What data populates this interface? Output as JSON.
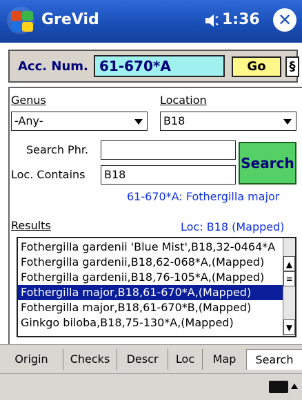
{
  "title_bar": {
    "app_title": "GreVid",
    "time": "1:36",
    "close_label": "✕",
    "sound_icon": "speaker-icon"
  },
  "acc_panel": {
    "label": "Acc. Num.",
    "value": "61-670*A",
    "go_label": "Go",
    "section_label": "§"
  },
  "search_panel": {
    "genus_label": "Genus",
    "genus_value": "-Any-",
    "location_label": "Location",
    "location_value": "B18",
    "search_phr_label": "Search Phr.",
    "search_phr_value": "",
    "loc_contains_label": "Loc. Contains",
    "loc_contains_value": "B18",
    "search_button": "Search",
    "status_text": "61-670*A: Fothergilla major"
  },
  "results": {
    "label": "Results",
    "loc_text": "Loc: B18 (Mapped)",
    "items": [
      "Fothergilla gardenii 'Blue Mist',B18,32-0464*A",
      "Fothergilla gardenii,B18,62-068*A,(Mapped)",
      "Fothergilla gardenii,B18,76-105*A,(Mapped)",
      "Fothergilla major,B18,61-670*A,(Mapped)",
      "Fothergilla major,B18,61-670*B,(Mapped)",
      "Ginkgo biloba,B18,75-130*A,(Mapped)"
    ],
    "selected_index": 3
  },
  "tabs": [
    "Origin",
    "Checks",
    "Descr",
    "Loc",
    "Map",
    "Search"
  ],
  "active_tab": "Search",
  "colors": {
    "title_bar": "#1a4fb8",
    "acc_input_bg": "#9ff0ee",
    "go_button_bg": "#fff78a",
    "search_button_bg": "#55d066",
    "selection_bg": "#0a1e9a",
    "blue_text": "#1030e0"
  }
}
